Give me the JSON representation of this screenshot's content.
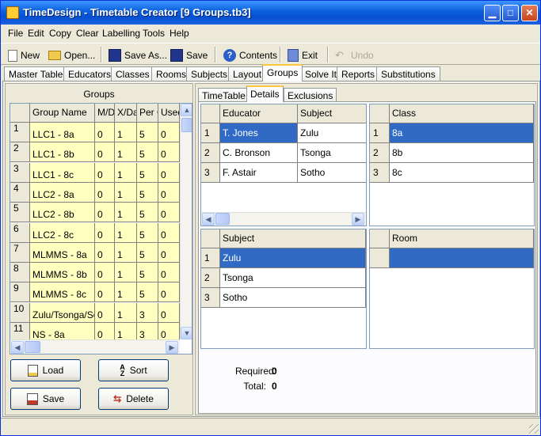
{
  "window": {
    "title": "TimeDesign - Timetable Creator [9 Groups.tb3]"
  },
  "menu": [
    "File",
    "Edit",
    "Copy",
    "Clear",
    "Labelling",
    "Tools",
    "Help"
  ],
  "toolbar": {
    "new": "New",
    "open": "Open...",
    "save_as": "Save As...",
    "save": "Save",
    "contents": "Contents",
    "exit": "Exit",
    "undo": "Undo"
  },
  "tabs": [
    "Master Table",
    "Educators",
    "Classes",
    "Rooms",
    "Subjects",
    "Layout",
    "Groups",
    "Solve It",
    "Reports",
    "Substitutions"
  ],
  "active_tab": "Groups",
  "groups": {
    "title": "Groups",
    "columns": [
      "Group Name",
      "M/D",
      "X/Da",
      "Per C",
      "Used"
    ],
    "rows": [
      {
        "n": "1",
        "name": "LLC1 - 8a",
        "md": "0",
        "xd": "1",
        "per": "5",
        "used": "0"
      },
      {
        "n": "2",
        "name": "LLC1 - 8b",
        "md": "0",
        "xd": "1",
        "per": "5",
        "used": "0"
      },
      {
        "n": "3",
        "name": "LLC1 - 8c",
        "md": "0",
        "xd": "1",
        "per": "5",
        "used": "0"
      },
      {
        "n": "4",
        "name": "LLC2 - 8a",
        "md": "0",
        "xd": "1",
        "per": "5",
        "used": "0"
      },
      {
        "n": "5",
        "name": "LLC2 - 8b",
        "md": "0",
        "xd": "1",
        "per": "5",
        "used": "0"
      },
      {
        "n": "6",
        "name": "LLC2 - 8c",
        "md": "0",
        "xd": "1",
        "per": "5",
        "used": "0"
      },
      {
        "n": "7",
        "name": "MLMMS - 8a",
        "md": "0",
        "xd": "1",
        "per": "5",
        "used": "0"
      },
      {
        "n": "8",
        "name": "MLMMS - 8b",
        "md": "0",
        "xd": "1",
        "per": "5",
        "used": "0"
      },
      {
        "n": "9",
        "name": "MLMMS - 8c",
        "md": "0",
        "xd": "1",
        "per": "5",
        "used": "0"
      },
      {
        "n": "10",
        "name": "Zulu/Tsonga/Sotho",
        "md": "0",
        "xd": "1",
        "per": "3",
        "used": "0"
      },
      {
        "n": "11",
        "name": "NS - 8a",
        "md": "0",
        "xd": "1",
        "per": "3",
        "used": "0"
      }
    ],
    "buttons": {
      "load": "Load",
      "sort": "Sort",
      "save": "Save",
      "delete": "Delete"
    }
  },
  "subtabs": [
    "TimeTable",
    "Details",
    "Exclusions"
  ],
  "active_subtab": "Details",
  "educator_grid": {
    "columns": [
      "Educator",
      "Subject"
    ],
    "rows": [
      {
        "n": "1",
        "educator": "T. Jones",
        "subject": "Zulu"
      },
      {
        "n": "2",
        "educator": "C. Bronson",
        "subject": "Tsonga"
      },
      {
        "n": "3",
        "educator": "F. Astair",
        "subject": "Sotho"
      }
    ]
  },
  "class_grid": {
    "columns": [
      "Class"
    ],
    "rows": [
      {
        "n": "1",
        "class": "8a"
      },
      {
        "n": "2",
        "class": "8b"
      },
      {
        "n": "3",
        "class": "8c"
      }
    ]
  },
  "subject_grid": {
    "columns": [
      "Subject"
    ],
    "rows": [
      {
        "n": "1",
        "subject": "Zulu"
      },
      {
        "n": "2",
        "subject": "Tsonga"
      },
      {
        "n": "3",
        "subject": "Sotho"
      }
    ]
  },
  "room_grid": {
    "columns": [
      "Room"
    ],
    "rows": [
      {
        "room": ""
      }
    ]
  },
  "totals": {
    "required_label": "Required:",
    "required_value": "0",
    "total_label": "Total:",
    "total_value": "0"
  }
}
